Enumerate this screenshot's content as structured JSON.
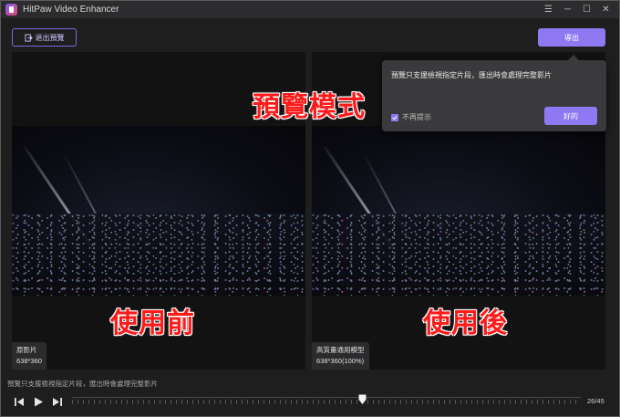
{
  "window": {
    "title": "HitPaw Video Enhancer",
    "controls": {
      "menu": "☰",
      "minimize": "─",
      "maximize": "☐",
      "close": "✕"
    }
  },
  "toolbar": {
    "exit_preview_label": "退出預覽",
    "export_label": "導出"
  },
  "overlays": {
    "preview_mode": "預覽模式",
    "before": "使用前",
    "after": "使用後"
  },
  "panes": {
    "left": {
      "name": "原影片",
      "resolution": "638*360"
    },
    "right": {
      "name": "高質量通用模型",
      "resolution": "638*360(100%)"
    }
  },
  "popup": {
    "message": "預覽只支援檢視指定片段，匯出時會處理完整影片",
    "checkbox_label": "不再提示",
    "checkbox_checked": true,
    "ok_label": "好的"
  },
  "footer": {
    "hint": "預覽只支援檢視指定片段，匯出時會處理完整影片",
    "frame_counter": "26/45",
    "progress": 0.57
  },
  "colors": {
    "accent": "#8f79f3",
    "overlay_text": "#ff1a1a",
    "background": "#1e1e1f"
  }
}
